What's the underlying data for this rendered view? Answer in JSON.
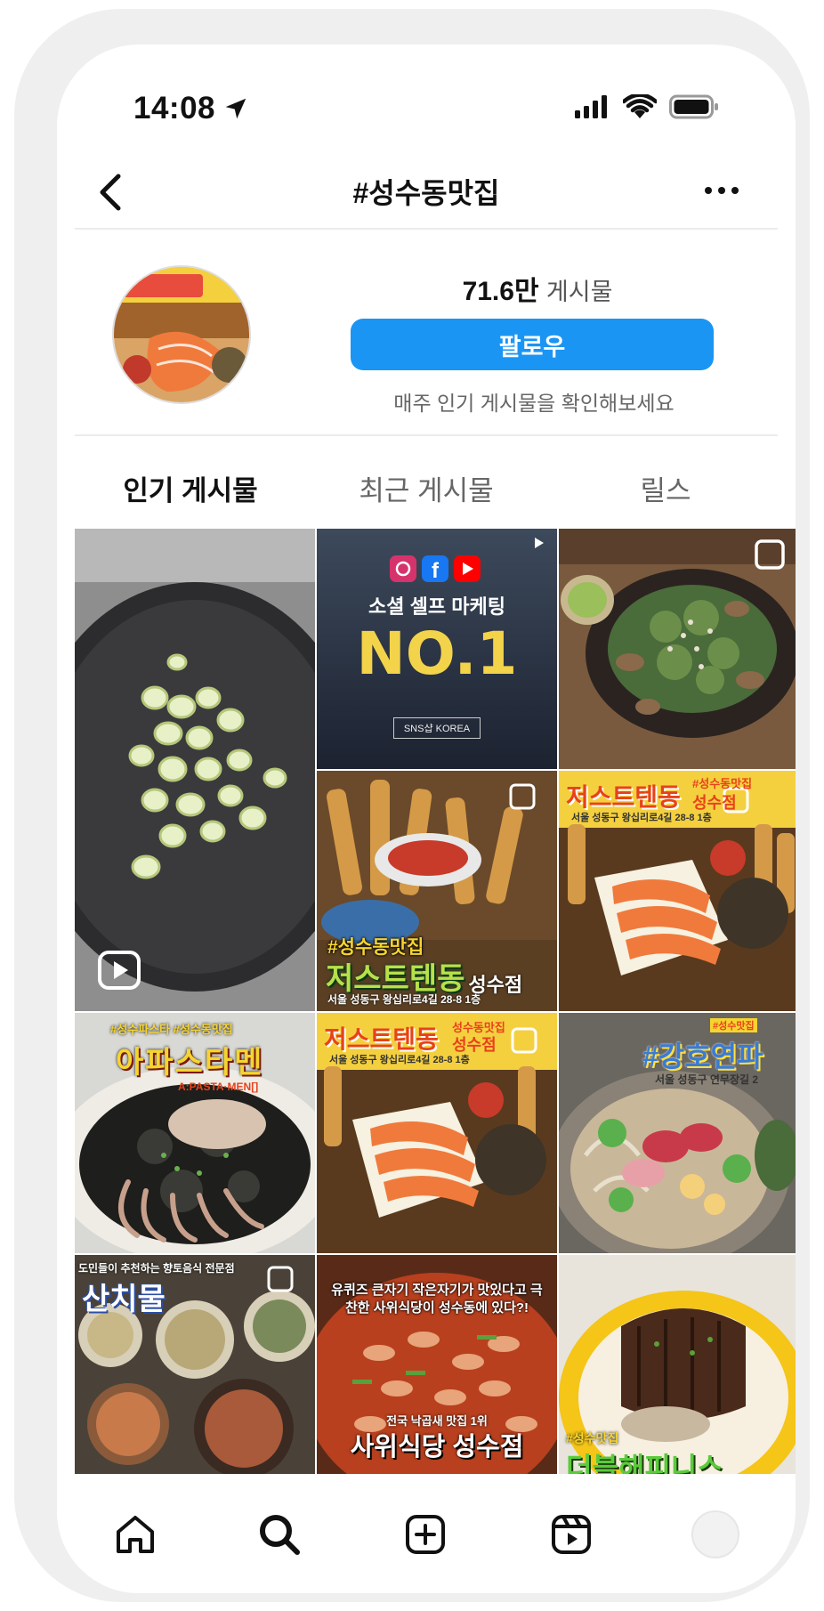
{
  "status_bar": {
    "time": "14:08",
    "icons": [
      "location-arrow-icon",
      "cellular-signal-icon",
      "wifi-icon",
      "battery-icon"
    ]
  },
  "header": {
    "back_icon": "chevron-left-icon",
    "title": "#성수동맛집",
    "more_icon": "ellipsis-icon"
  },
  "hashtag_profile": {
    "post_count_value": "71.6만",
    "post_count_unit": "게시물",
    "follow_label": "팔로우",
    "weekly_note": "매주 인기 게시물을 확인해보세요"
  },
  "tabs": [
    {
      "label": "인기 게시물",
      "active": true
    },
    {
      "label": "최근 게시물",
      "active": false
    },
    {
      "label": "릴스",
      "active": false
    }
  ],
  "grid": {
    "ad_post": {
      "title_line": "소셜 셀프 마케팅",
      "big_text": "NO.1",
      "badge_text": "SNS샵 KOREA"
    },
    "posts": [
      {
        "id": "tendon-1",
        "title": "#성수동맛집",
        "name": "저스트텐동",
        "branch": "성수점",
        "address": "서울 성동구 왕십리로4길 28-8 1층"
      },
      {
        "id": "tendon-2",
        "tag": "#성수동맛집",
        "name": "저스트텐동",
        "branch": "성수점",
        "address": "서울 성동구 왕십리로4길 28-8 1층"
      },
      {
        "id": "pasta",
        "tag": "#성수파스타 #성수동맛집",
        "name": "아파스타멘",
        "subtitle": "A:PASTA·MEN[]"
      },
      {
        "id": "tendon-3",
        "tag": "성수동맛집",
        "name": "저스트텐동",
        "branch": "성수점",
        "address": "서울 성동구 왕십리로4길 28-8 1층"
      },
      {
        "id": "gangho",
        "tag": "#성수맛집",
        "name": "#강호연파",
        "subtitle": "서울 성동구 연무장길 2"
      },
      {
        "id": "sanchimul",
        "tag": "도민들이 추천하는 향토음식 전문점",
        "name": "산치물"
      },
      {
        "id": "sawui",
        "headline": "유퀴즈 큰자기 작은자기가 맛있다고 극찬한 사위식당이 성수동에 있다?!",
        "award": "전국 낙곱새 맛집 1위",
        "name": "사위식당 성수점"
      },
      {
        "id": "double",
        "tag": "#성수맛집",
        "name": "더블해피니스"
      }
    ]
  },
  "bottom_nav": [
    {
      "icon": "home-icon"
    },
    {
      "icon": "search-icon"
    },
    {
      "icon": "add-post-icon"
    },
    {
      "icon": "reels-icon"
    },
    {
      "icon": "profile-avatar-icon"
    }
  ],
  "colors": {
    "follow_button": "#1a95f3",
    "divider": "#ececec",
    "frame": "#efefef"
  }
}
